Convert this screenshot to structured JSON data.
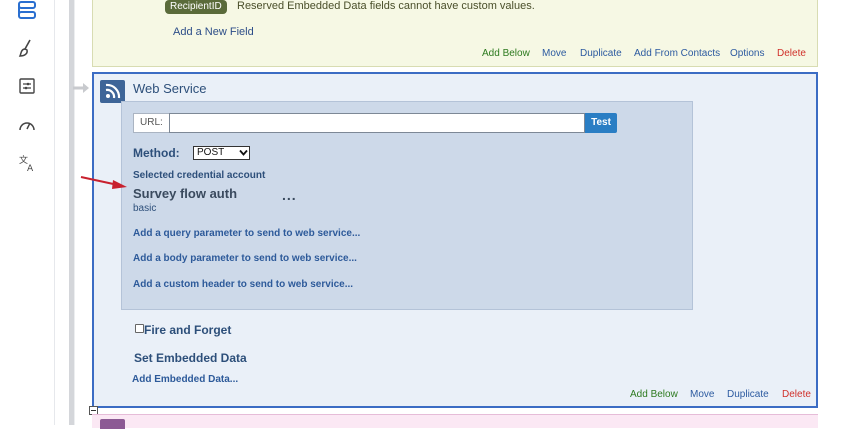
{
  "nav": {
    "icons": [
      "survey-flow-icon",
      "look-and-feel-icon",
      "survey-options-icon",
      "dashboard-icon",
      "translate-icon"
    ]
  },
  "embedded_block": {
    "badge": "RecipientID",
    "reserved_text": "Reserved Embedded Data fields cannot have custom values.",
    "add_field": "Add a New Field",
    "actions": {
      "add_below": "Add Below",
      "move": "Move",
      "duplicate": "Duplicate",
      "add_from_contacts": "Add From Contacts",
      "options": "Options",
      "delete": "Delete"
    }
  },
  "web_service": {
    "title": "Web Service",
    "url_label": "URL:",
    "url_value": "",
    "test_label": "Test",
    "method_label": "Method:",
    "method_value": "POST",
    "credential_label": "Selected credential account",
    "credential_name": "Survey flow auth",
    "credential_menu": "...",
    "credential_type": "basic",
    "add_query": "Add a query parameter to send to web service...",
    "add_body": "Add a body parameter to send to web service...",
    "add_header": "Add a custom header to send to web service...",
    "fire_and_forget": "Fire and Forget",
    "fire_and_forget_checked": false,
    "set_embedded": "Set Embedded Data",
    "add_embedded": "Add Embedded Data...",
    "actions": {
      "add_below": "Add Below",
      "move": "Move",
      "duplicate": "Duplicate",
      "delete": "Delete"
    }
  },
  "colors": {
    "accent_blue": "#3b6cc4",
    "action_green": "#2d7a1f",
    "action_blue": "#2c5aa0",
    "action_red": "#d0302a",
    "annotation_red": "#c8202e"
  }
}
